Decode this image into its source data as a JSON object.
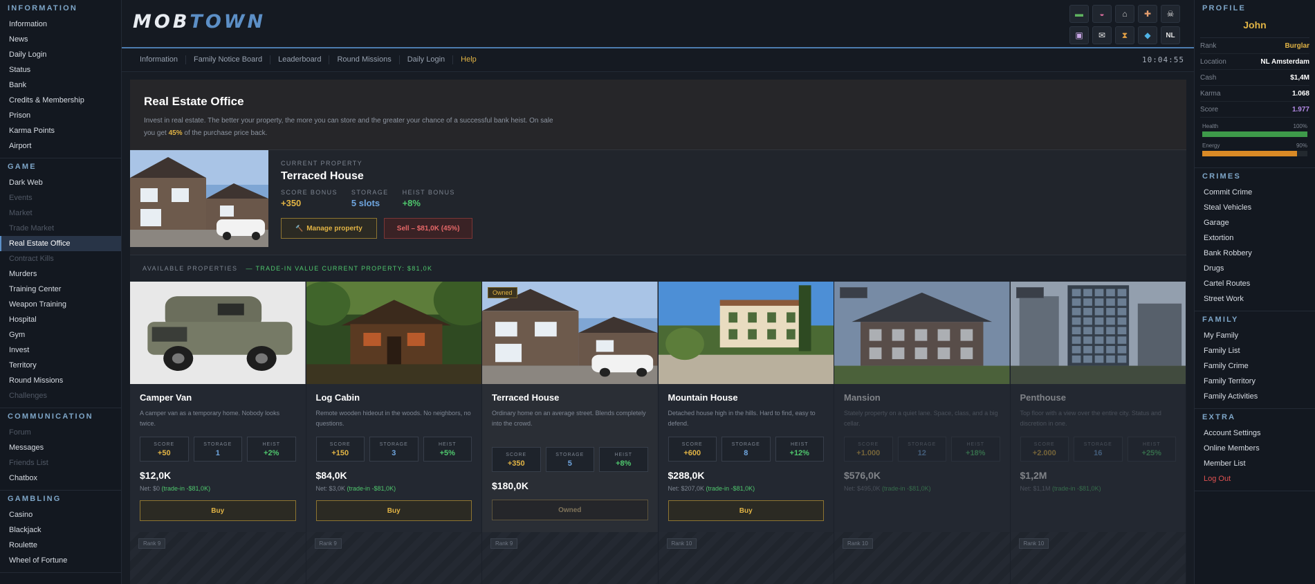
{
  "left_sidebar": {
    "sections": [
      {
        "title": "INFORMATION",
        "items": [
          {
            "label": "Information",
            "state": "normal"
          },
          {
            "label": "News",
            "state": "normal"
          },
          {
            "label": "Daily Login",
            "state": "normal"
          },
          {
            "label": "Status",
            "state": "normal"
          },
          {
            "label": "Bank",
            "state": "normal"
          },
          {
            "label": "Credits & Membership",
            "state": "normal"
          },
          {
            "label": "Prison",
            "state": "normal"
          },
          {
            "label": "Karma Points",
            "state": "normal"
          },
          {
            "label": "Airport",
            "state": "normal"
          }
        ]
      },
      {
        "title": "GAME",
        "items": [
          {
            "label": "Dark Web",
            "state": "normal"
          },
          {
            "label": "Events",
            "state": "disabled"
          },
          {
            "label": "Market",
            "state": "disabled"
          },
          {
            "label": "Trade Market",
            "state": "disabled"
          },
          {
            "label": "Real Estate Office",
            "state": "active"
          },
          {
            "label": "Contract Kills",
            "state": "disabled"
          },
          {
            "label": "Murders",
            "state": "normal"
          },
          {
            "label": "Training Center",
            "state": "normal"
          },
          {
            "label": "Weapon Training",
            "state": "normal"
          },
          {
            "label": "Hospital",
            "state": "normal"
          },
          {
            "label": "Gym",
            "state": "normal"
          },
          {
            "label": "Invest",
            "state": "normal"
          },
          {
            "label": "Territory",
            "state": "normal"
          },
          {
            "label": "Round Missions",
            "state": "normal"
          },
          {
            "label": "Challenges",
            "state": "disabled"
          }
        ]
      },
      {
        "title": "COMMUNICATION",
        "items": [
          {
            "label": "Forum",
            "state": "disabled"
          },
          {
            "label": "Messages",
            "state": "normal"
          },
          {
            "label": "Friends List",
            "state": "disabled"
          },
          {
            "label": "Chatbox",
            "state": "normal"
          }
        ]
      },
      {
        "title": "GAMBLING",
        "items": [
          {
            "label": "Casino",
            "state": "normal"
          },
          {
            "label": "Blackjack",
            "state": "normal"
          },
          {
            "label": "Roulette",
            "state": "normal"
          },
          {
            "label": "Wheel of Fortune",
            "state": "normal"
          }
        ]
      }
    ]
  },
  "header": {
    "logo_part1": "MOB",
    "logo_part2": "TOWN",
    "quick_icons": [
      {
        "icon": "cash-icon",
        "glyph": "▬",
        "color": "#5fb35f"
      },
      {
        "icon": "car-icon",
        "glyph": "◒",
        "color": "#d46a9a"
      },
      {
        "icon": "bank-icon",
        "glyph": "⌂",
        "color": "#c8c8c8"
      },
      {
        "icon": "bandage-icon",
        "glyph": "✚",
        "color": "#e8a070"
      },
      {
        "icon": "skull-icon",
        "glyph": "☠",
        "color": "#e0e0e0"
      },
      {
        "icon": "bus-icon",
        "glyph": "▣",
        "color": "#c9a7e6"
      },
      {
        "icon": "envelope-icon",
        "glyph": "✉",
        "color": "#e6e6e6"
      },
      {
        "icon": "hourglass-icon",
        "glyph": "⧗",
        "color": "#e2a045"
      },
      {
        "icon": "gem-icon",
        "glyph": "◆",
        "color": "#4fb3e6"
      },
      {
        "icon": "language-nl-icon",
        "glyph": "NL",
        "color": "#e6e6e6"
      }
    ]
  },
  "nav": {
    "items": [
      "Information",
      "Family Notice Board",
      "Leaderboard",
      "Round Missions",
      "Daily Login",
      "Help"
    ],
    "clock": "10:04:55"
  },
  "hero": {
    "title": "Real Estate Office",
    "text1": "Invest in real estate. The better your property, the more you can store and the greater your chance of a successful bank heist. On sale you get ",
    "pct": "45%",
    "text2": " of the purchase price back."
  },
  "current": {
    "label": "CURRENT PROPERTY",
    "name": "Terraced House",
    "score_label": "SCORE BONUS",
    "score": "+350",
    "storage_label": "STORAGE",
    "storage": "5 slots",
    "heist_label": "HEIST BONUS",
    "heist": "+8%",
    "manage_label": "Manage property",
    "manage_icon": "🔨",
    "sell_label": "Sell – $81,0K (45%)"
  },
  "available": {
    "label": "AVAILABLE PROPERTIES",
    "tradein": "— TRADE-IN VALUE CURRENT PROPERTY: $81,0K"
  },
  "stat_labels": {
    "score": "SCORE",
    "storage": "STORAGE",
    "heist": "HEIST"
  },
  "properties": [
    {
      "name": "Camper Van",
      "desc": "A camper van as a temporary home. Nobody looks twice.",
      "score": "+50",
      "storage": "1",
      "heist": "+2%",
      "price": "$12,0K",
      "net_prefix": "Net: $0",
      "net_trade": " (trade-in -$81,0K)",
      "button": "Buy",
      "state": "buy",
      "tag": ""
    },
    {
      "name": "Log Cabin",
      "desc": "Remote wooden hideout in the woods. No neighbors, no questions.",
      "score": "+150",
      "storage": "3",
      "heist": "+5%",
      "price": "$84,0K",
      "net_prefix": "Net: $3,0K",
      "net_trade": " (trade-in -$81,0K)",
      "button": "Buy",
      "state": "buy",
      "tag": ""
    },
    {
      "name": "Terraced House",
      "desc": "Ordinary home on an average street. Blends completely into the crowd.",
      "score": "+350",
      "storage": "5",
      "heist": "+8%",
      "price": "$180,0K",
      "net_prefix": "",
      "net_trade": "",
      "button": "Owned",
      "state": "owned",
      "tag": "Owned"
    },
    {
      "name": "Mountain House",
      "desc": "Detached house high in the hills. Hard to find, easy to defend.",
      "score": "+600",
      "storage": "8",
      "heist": "+12%",
      "price": "$288,0K",
      "net_prefix": "Net: $207,0K",
      "net_trade": " (trade-in -$81,0K)",
      "button": "Buy",
      "state": "buy",
      "tag": ""
    },
    {
      "name": "Mansion",
      "desc": "Stately property on a quiet lane. Space, class, and a big cellar.",
      "score": "+1.000",
      "storage": "12",
      "heist": "+18%",
      "price": "$576,0K",
      "net_prefix": "Net: $495,0K",
      "net_trade": " (trade-in -$81,0K)",
      "button": "",
      "state": "locked",
      "tag": ""
    },
    {
      "name": "Penthouse",
      "desc": "Top floor with a view over the entire city. Status and discretion in one.",
      "score": "+2.000",
      "storage": "16",
      "heist": "+25%",
      "price": "$1,2M",
      "net_prefix": "Net: $1,1M",
      "net_trade": " (trade-in -$81,0K)",
      "button": "",
      "state": "locked",
      "tag": ""
    }
  ],
  "row2_ranks": [
    "Rank 9",
    "Rank 9",
    "Rank 9",
    "Rank 10",
    "Rank 10",
    "Rank 10"
  ],
  "profile": {
    "title": "PROFILE",
    "name": "John",
    "rows": [
      {
        "k": "Rank",
        "v": "Burglar",
        "style": "gold"
      },
      {
        "k": "Location",
        "v": "NL Amsterdam",
        "style": "white"
      },
      {
        "k": "Cash",
        "v": "$1,4M",
        "style": "white"
      },
      {
        "k": "Karma",
        "v": "1.068",
        "style": "white"
      },
      {
        "k": "Score",
        "v": "1.977",
        "style": "purple"
      }
    ],
    "health_label": "Health",
    "health_value": "100%",
    "health": 1.0,
    "energy_label": "Energy",
    "energy_value": "90%",
    "energy": 0.9
  },
  "right_sections": [
    {
      "title": "CRIMES",
      "items": [
        "Commit Crime",
        "Steal Vehicles",
        "Garage",
        "Extortion",
        "Bank Robbery",
        "Drugs",
        "Cartel Routes",
        "Street Work"
      ]
    },
    {
      "title": "FAMILY",
      "items": [
        "My Family",
        "Family List",
        "Family Crime",
        "Family Territory",
        "Family Activities"
      ]
    },
    {
      "title": "EXTRA",
      "items": [
        "Account Settings",
        "Online Members",
        "Member List",
        "Log Out"
      ]
    }
  ],
  "colors": {
    "accent_gold": "#e2b445",
    "accent_blue": "#5c8fc6",
    "success": "#4fc76d",
    "danger": "#e05252",
    "health_bar": "#3e9a4a",
    "energy_bar": "#d98a26"
  }
}
